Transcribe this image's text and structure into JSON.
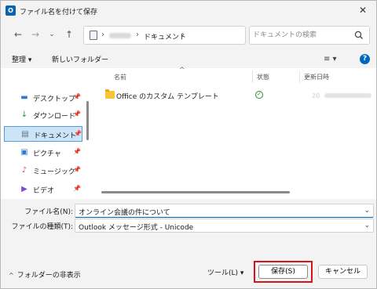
{
  "window": {
    "title": "ファイル名を付けて保存",
    "app_icon_letter": "O",
    "close_glyph": "✕"
  },
  "navigation": {
    "back_glyph": "←",
    "forward_glyph": "→",
    "recent_glyph": "⌄",
    "up_glyph": "↑",
    "address": {
      "crumb": "ドキュメント",
      "separator": "›",
      "dropdown_glyph": "⌄",
      "refresh_glyph": "↻"
    },
    "search": {
      "placeholder": "ドキュメントの検索"
    }
  },
  "toolbar": {
    "organize_label": "整理 ▾",
    "new_folder_label": "新しいフォルダー",
    "view_glyph": "≡ ▾",
    "help_glyph": "?"
  },
  "sidebar": {
    "pin_glyph": "📌",
    "items": [
      {
        "label": "デスクトップ",
        "icon": "desktop-icon",
        "glyph": "▬",
        "color": "#2a7bd4"
      },
      {
        "label": "ダウンロード",
        "icon": "download-icon",
        "glyph": "↓",
        "color": "#2e8b3a"
      },
      {
        "label": "ドキュメント",
        "icon": "documents-icon",
        "glyph": "▤",
        "color": "#5b6f8a",
        "selected": true
      },
      {
        "label": "ピクチャ",
        "icon": "pictures-icon",
        "glyph": "▣",
        "color": "#2a7bd4"
      },
      {
        "label": "ミュージック",
        "icon": "music-icon",
        "glyph": "♪",
        "color": "#d2456a"
      },
      {
        "label": "ビデオ",
        "icon": "videos-icon",
        "glyph": "▶",
        "color": "#7b4fc9"
      }
    ]
  },
  "file_list": {
    "columns": {
      "name": "名前",
      "status": "状態",
      "modified": "更新日時"
    },
    "sort_glyph": "^",
    "rows": [
      {
        "name": "Office のカスタム テンプレート",
        "status_icon": "synced-icon",
        "status_glyph": "✓",
        "modified": "20"
      }
    ]
  },
  "form": {
    "filename_label": "ファイル名(N):",
    "filename_value": "オンライン会議の件について",
    "filetype_label": "ファイルの種類(T):",
    "filetype_value": "Outlook メッセージ形式 - Unicode",
    "caret_glyph": "⌄"
  },
  "footer": {
    "hide_folders_label": "フォルダーの非表示",
    "hide_folders_caret": "^",
    "tools_label": "ツール(L)  ▾",
    "save_label": "保存(S)",
    "cancel_label": "キャンセル"
  },
  "colors": {
    "highlight": "#d8141b",
    "selection": "#cce4f7",
    "accent": "#0067c0"
  }
}
